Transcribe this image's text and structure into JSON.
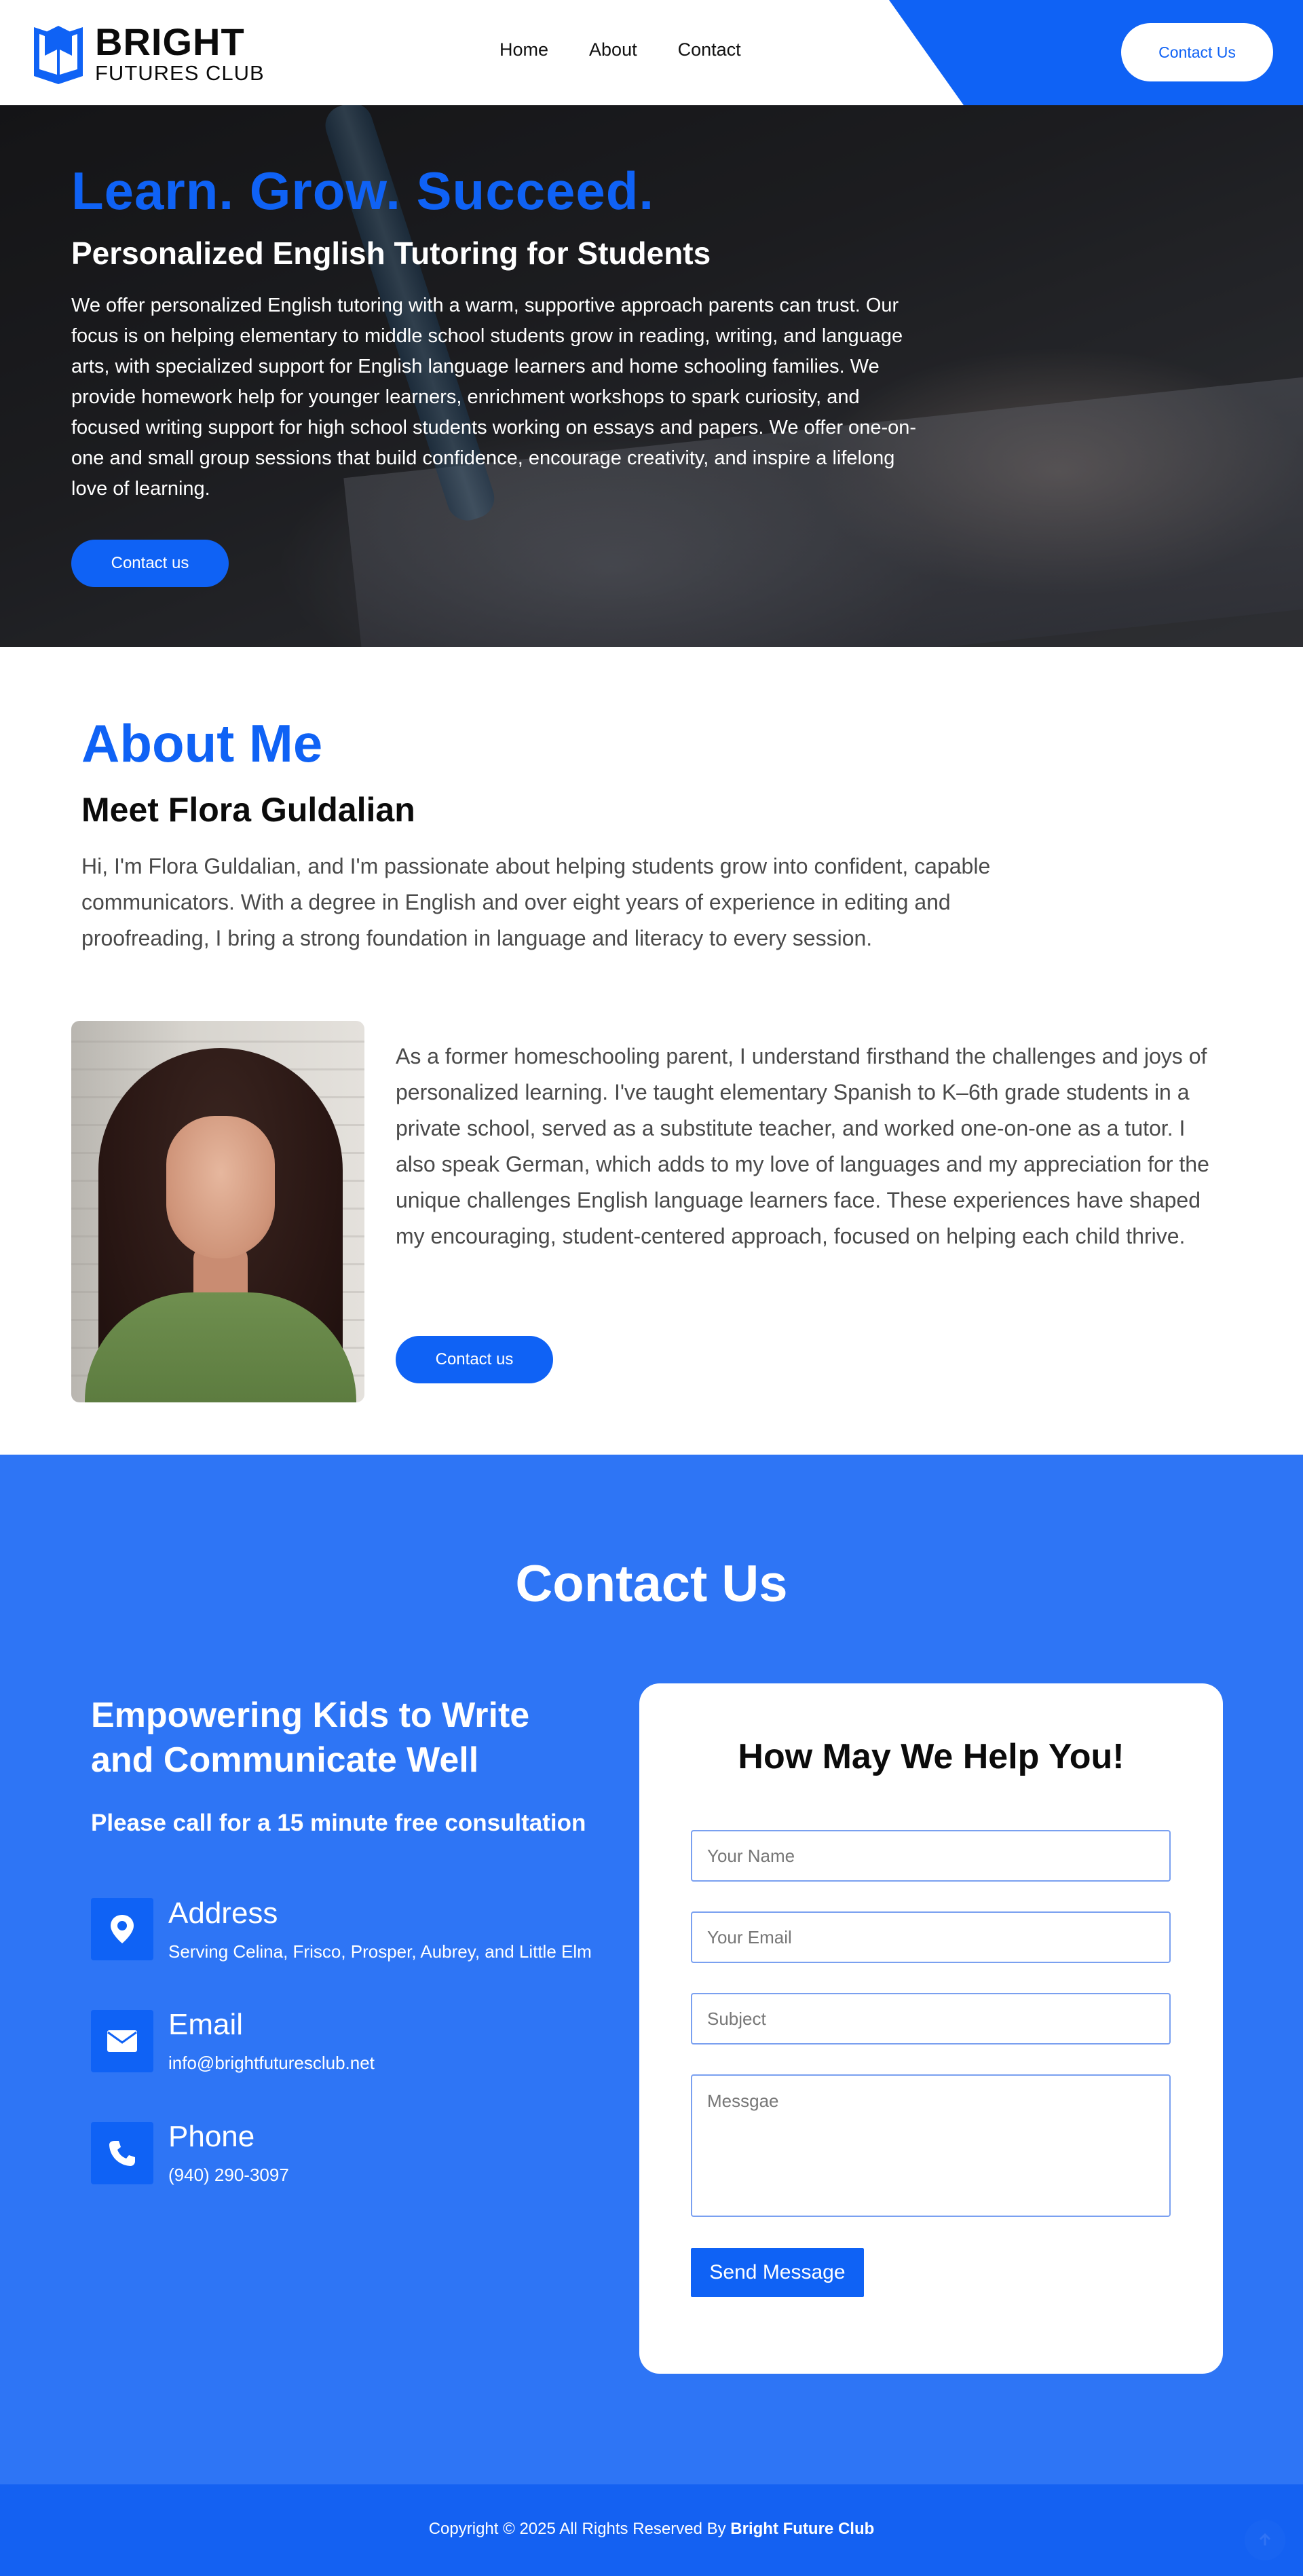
{
  "header": {
    "logo_line1": "BRIGHT",
    "logo_line2": "FUTURES CLUB",
    "nav": [
      "Home",
      "About",
      "Contact"
    ],
    "cta_label": "Contact Us"
  },
  "hero": {
    "title": "Learn. Grow. Succeed.",
    "subtitle": "Personalized English Tutoring for Students",
    "body": "We offer personalized English tutoring with a warm, supportive approach parents can trust. Our focus is on helping elementary to middle school students grow in reading, writing, and language arts, with specialized support for English language learners and home schooling families. We provide homework help for younger learners, enrichment workshops to spark curiosity, and focused writing support for high school students working on essays and papers. We offer one-on-one and small group sessions that build confidence, encourage creativity, and inspire a lifelong love of learning.",
    "button_label": "Contact us"
  },
  "about": {
    "title": "About Me",
    "subtitle": "Meet Flora Guldalian",
    "body1": "Hi, I'm Flora Guldalian, and I'm passionate about helping students grow into confident, capable communicators. With a degree in English and over eight years of experience in editing and proofreading, I bring a strong foundation in language and literacy to every session.",
    "body2": "As a former homeschooling parent, I understand firsthand the challenges and joys of personalized learning. I've taught elementary Spanish to K–6th grade students in a private school, served as a substitute teacher, and worked one-on-one as a tutor. I also speak German, which adds to my love of languages and my appreciation for the unique challenges English language learners face. These experiences have shaped my encouraging, student-centered approach, focused on helping each child thrive.",
    "button_label": "Contact us"
  },
  "contact": {
    "title": "Contact Us",
    "heading": "Empowering Kids to Write and Communicate Well",
    "call_text": "Please call for a 15 minute free consultation",
    "items": [
      {
        "icon": "map-pin-icon",
        "title": "Address",
        "text": "Serving Celina, Frisco, Prosper, Aubrey, and Little Elm"
      },
      {
        "icon": "envelope-icon",
        "title": "Email",
        "text": "info@brightfuturesclub.net"
      },
      {
        "icon": "phone-icon",
        "title": "Phone",
        "text": "(940) 290-3097"
      }
    ],
    "form": {
      "title": "How May We Help You!",
      "name_placeholder": "Your Name",
      "email_placeholder": "Your Email",
      "subject_placeholder": "Subject",
      "message_placeholder": "Messgae",
      "send_label": "Send Message"
    }
  },
  "footer": {
    "copyright": "Copyright © 2025 All Rights Reserved By",
    "brand": "Bright Future Club"
  },
  "colors": {
    "brand_blue": "#0f62f5",
    "section_blue": "#2e75f5",
    "footer_blue": "#1461f2"
  }
}
